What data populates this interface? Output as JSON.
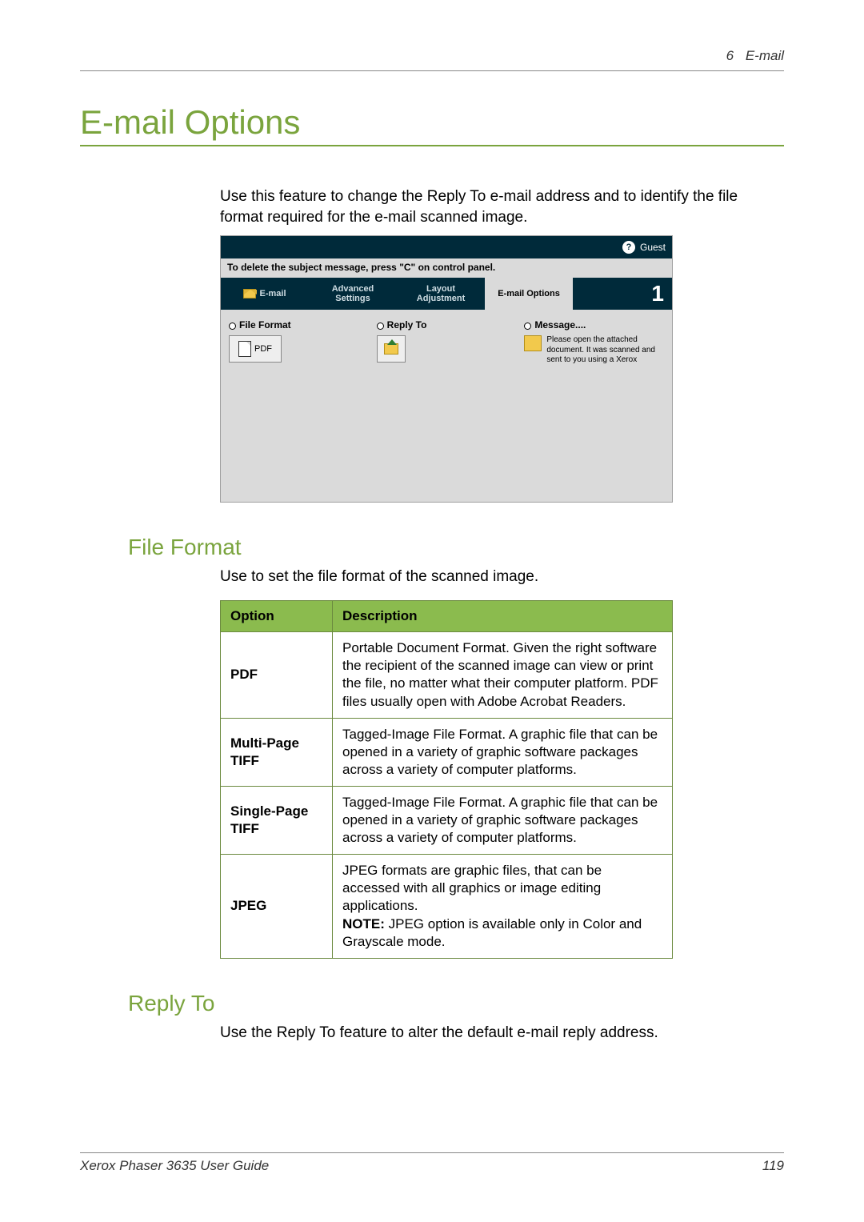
{
  "header": {
    "chapter": "6",
    "section": "E-mail"
  },
  "h1": "E-mail Options",
  "intro": "Use this feature to change the Reply To e-mail address and to identify the file format required for the e-mail scanned image.",
  "screenshot": {
    "guest": "Guest",
    "hint": "To delete the subject message, press \"C\" on control panel.",
    "tabs": {
      "email": "E-mail",
      "advanced": "Advanced Settings",
      "layout": "Layout Adjustment",
      "options": "E-mail Options"
    },
    "indicator": "1",
    "cols": {
      "fileformat": {
        "title": "File Format",
        "value": "PDF"
      },
      "replyto": {
        "title": "Reply To"
      },
      "message": {
        "title": "Message....",
        "text": "Please open the attached document. It was scanned and sent to you using a Xerox"
      }
    }
  },
  "fileFormat": {
    "heading": "File Format",
    "intro": "Use to set the file format of the scanned image.",
    "table": {
      "head_option": "Option",
      "head_desc": "Description",
      "rows": [
        {
          "name": "PDF",
          "desc": "Portable Document Format. Given the right software the recipient of the scanned image can view or print the file, no matter what their computer platform. PDF files usually open with Adobe Acrobat Readers."
        },
        {
          "name": "Multi-Page TIFF",
          "desc": "Tagged-Image File Format. A graphic file that can be opened in a variety of graphic software packages across a variety of computer platforms."
        },
        {
          "name": "Single-Page TIFF",
          "desc": "Tagged-Image File Format. A graphic file that can be opened in a variety of graphic software packages across a variety of computer platforms."
        },
        {
          "name": "JPEG",
          "desc_main": "JPEG formats are graphic files, that can be accessed with all graphics or image editing applications.",
          "note_label": "NOTE:",
          "note_text": " JPEG option is available only in Color and Grayscale mode."
        }
      ]
    }
  },
  "replyTo": {
    "heading": "Reply To",
    "intro": "Use the Reply To feature to alter the default e-mail reply address."
  },
  "footer": {
    "left": "Xerox Phaser 3635 User Guide",
    "right": "119"
  }
}
